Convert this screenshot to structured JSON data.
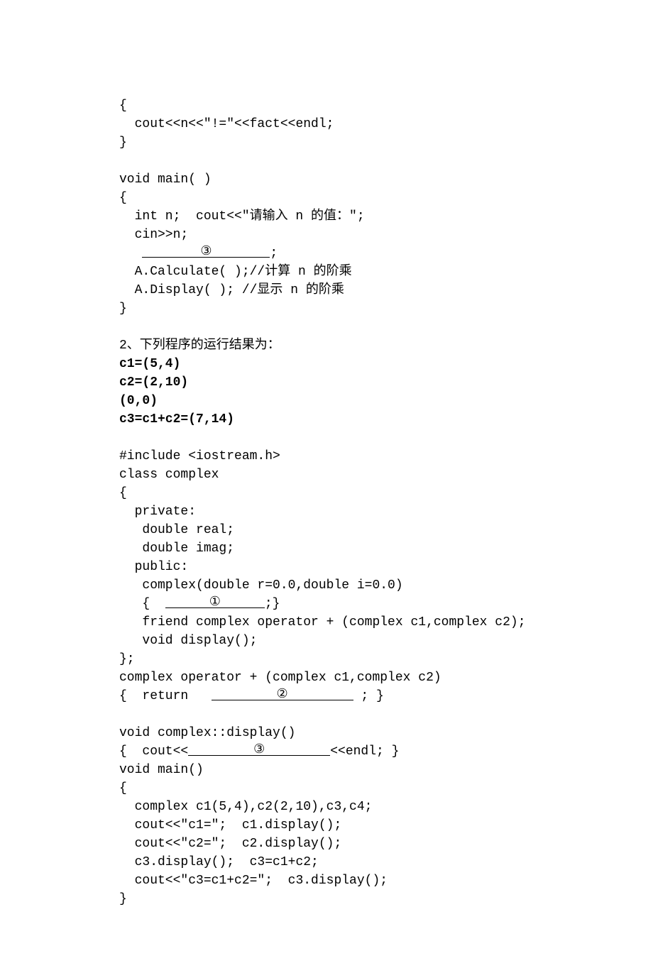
{
  "lines": {
    "l01": "{",
    "l02": "  cout<<n<<\"!=\"<<fact<<endl;",
    "l03": "}",
    "l04": "",
    "l05": "void main( )",
    "l06": "{",
    "l07": "  int n;  cout<<\"请输入 n 的值：\";",
    "l08": "  cin>>n;",
    "l09a": "   ",
    "l09b": ";",
    "l10": "  A.Calculate( );//计算 n 的阶乘",
    "l11": "  A.Display( ); //显示 n 的阶乘",
    "l12": "}",
    "l13": "",
    "l14": "2、下列程序的运行结果为：",
    "l15": "c1=(5,4)",
    "l16": "c2=(2,10)",
    "l17": "(0,0)",
    "l18": "c3=c1+c2=(7,14)",
    "l19": "",
    "l20": "#include <iostream.h>",
    "l21": "class complex",
    "l22": "{",
    "l23": "  private:",
    "l24": "   double real;",
    "l25": "   double imag;",
    "l26": "  public:",
    "l27": "   complex(double r=0.0,double i=0.0)",
    "l28a": "   {  ",
    "l28b": ";}",
    "l29": "   friend complex operator + (complex c1,complex c2);",
    "l30": "   void display();",
    "l31": "};",
    "l32": "complex operator + (complex c1,complex c2)",
    "l33a": "{  return   ",
    "l33b": " ; }",
    "l34": "",
    "l35": "void complex::display()",
    "l36a": "{  cout<<",
    "l36b": "<<endl; }",
    "l37": "void main()",
    "l38": "{",
    "l39": "  complex c1(5,4),c2(2,10),c3,c4;",
    "l40": "  cout<<\"c1=\";  c1.display();",
    "l41": "  cout<<\"c2=\";  c2.display();",
    "l42": "  c3.display();  c3=c1+c2;",
    "l43": "  cout<<\"c3=c1+c2=\";  c3.display();",
    "l44": "}"
  },
  "blanks": {
    "b3": "③",
    "b1": "①",
    "b2": "②",
    "b3b": "③"
  }
}
